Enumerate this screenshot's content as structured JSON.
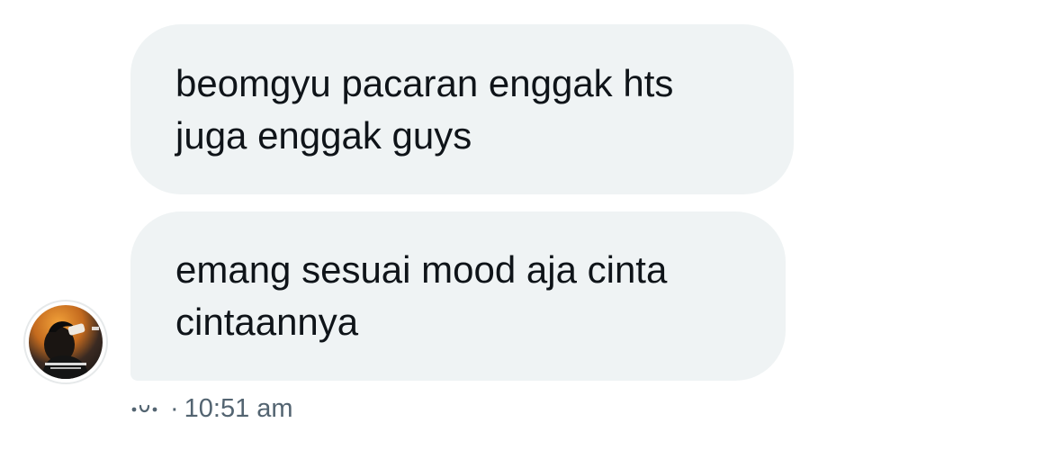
{
  "messages": [
    {
      "text": "beomgyu pacaran enggak hts\njuga enggak guys"
    },
    {
      "text": "emang sesuai mood aja cinta\ncintaannya"
    }
  ],
  "meta": {
    "separator": "·",
    "time": "10:51 am"
  },
  "icons": {
    "status": "seen-icon",
    "avatar": "avatar"
  },
  "colors": {
    "bubble": "#eff3f4",
    "text": "#0f1419",
    "meta": "#536471"
  }
}
